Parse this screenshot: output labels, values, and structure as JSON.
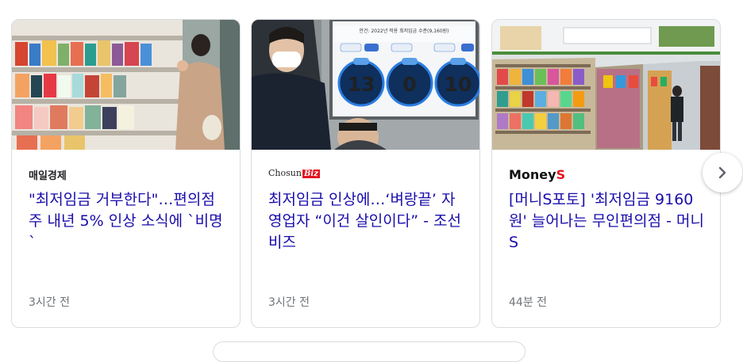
{
  "colors": {
    "headline": "#1a0dab",
    "source": "#202124",
    "time": "#70757a",
    "border": "#dadce0",
    "moneys_accent": "#e3141f"
  },
  "cards": [
    {
      "source": "매일경제",
      "headline": "\"최저임금 거부한다\"…편의점주 내년 5% 인상 소식에 `비명`",
      "time": "3시간 전",
      "image": "convenience-store-shelves-woman-photo"
    },
    {
      "source_text": "Chosun",
      "source_suffix": "Biz",
      "headline": "최저임금 인상에…‘벼랑끝’ 자영업자 “이건 살인이다” - 조선비즈",
      "time": "3시간 전",
      "image": "wage-committee-vote-screen-photo",
      "screen": {
        "title": "안건: 2022년 적용 최저임금 수준(9,160원)",
        "votes": [
          "13",
          "0",
          "10"
        ]
      }
    },
    {
      "source_text": "Money",
      "source_suffix": "S",
      "headline": "[머니S포토] '최저임금 9160원' 늘어나는 무인편의점 - 머니S",
      "time": "44분 전",
      "image": "unmanned-convenience-store-photo"
    }
  ],
  "next_button": {
    "icon": "chevron-right-icon"
  }
}
